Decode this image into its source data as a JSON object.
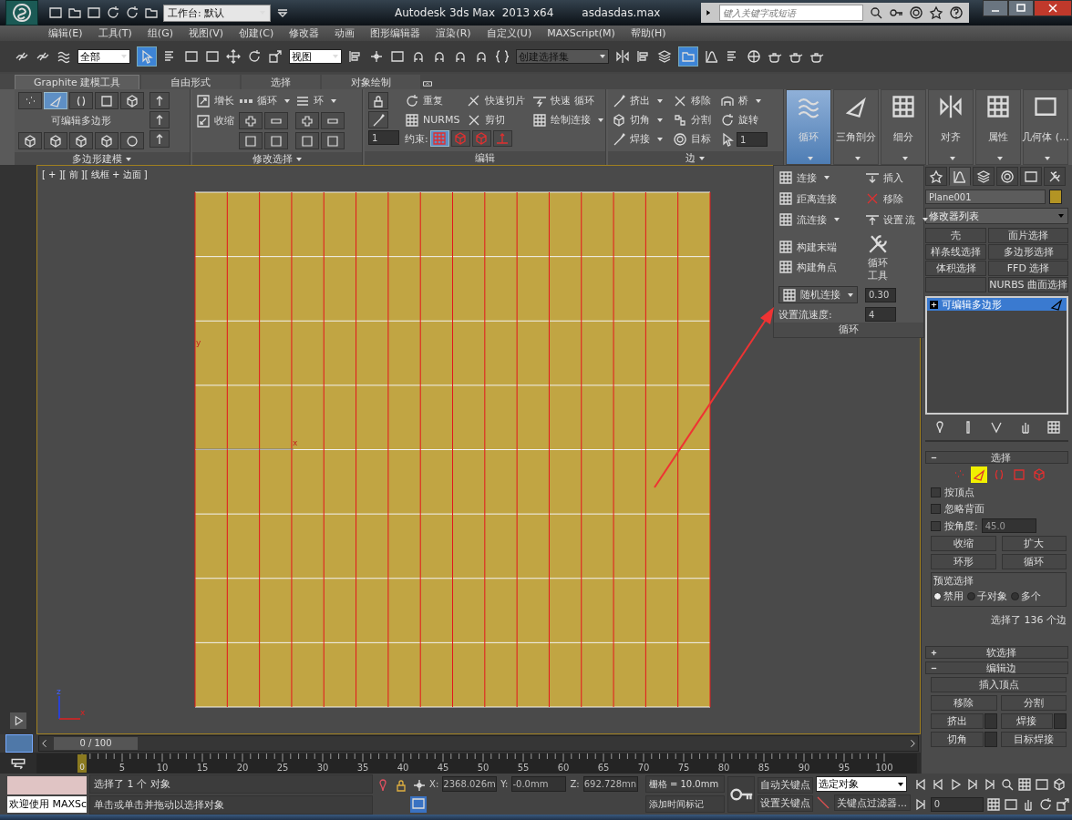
{
  "title_bar": {
    "workspace": "工作台: 默认",
    "app_title": "Autodesk 3ds Max  2013 x64",
    "file_name": "asdasdas.max",
    "search": {
      "placeholder": "键入关键字或短语"
    }
  },
  "menu_bar": [
    "编辑(E)",
    "工具(T)",
    "组(G)",
    "视图(V)",
    "创建(C)",
    "修改器",
    "动画",
    "图形编辑器",
    "渲染(R)",
    "自定义(U)",
    "MAXScript(M)",
    "帮助(H)"
  ],
  "main_toolbar": {
    "selection_filter": "全部",
    "select_object": {
      "on": true
    },
    "reference_coordinate": "视图",
    "named_selection_set": "创建选择集",
    "ribbon_toggle": {
      "on": true
    }
  },
  "ribbon": {
    "tabs": [
      {
        "label": "Graphite 建模工具",
        "selected": true
      },
      {
        "label": "自由形式",
        "selected": false
      },
      {
        "label": "选择",
        "selected": false
      },
      {
        "label": "对象绘制",
        "selected": false
      }
    ],
    "polygon_modeling": {
      "title": "多边形建模",
      "object_type": "可编辑多边形",
      "subobject_levels": [
        {
          "kind": "vertex",
          "selected": false
        },
        {
          "kind": "edge",
          "selected": true
        },
        {
          "kind": "border",
          "selected": false
        },
        {
          "kind": "polygon",
          "selected": false
        },
        {
          "kind": "element",
          "selected": false
        }
      ]
    },
    "modify_selection": {
      "title": "修改选择",
      "grow": "增长",
      "shrink": "收缩",
      "loop": "循环",
      "ring": "环"
    },
    "edit": {
      "title": "编辑",
      "repeat": "重复",
      "quickslice": "快速切片",
      "swiftloop": "快速 循环",
      "nurms": "NURMS",
      "cut": "剪切",
      "paint_connect": "绘制连接",
      "constraints_label": "约束:",
      "constraints": [
        {
          "kind": "none",
          "selected": true
        },
        {
          "kind": "edge",
          "selected": false
        },
        {
          "kind": "face",
          "selected": false
        },
        {
          "kind": "normal",
          "selected": false
        }
      ],
      "spinner": "1"
    },
    "edges": {
      "title": "边",
      "tools": [
        {
          "label": "挤出",
          "dropdown": true
        },
        {
          "label": "移除",
          "dropdown": false
        },
        {
          "label": "桥",
          "dropdown": true
        },
        {
          "label": "切角",
          "dropdown": true
        },
        {
          "label": "分割",
          "dropdown": false
        },
        {
          "label": "旋转",
          "dropdown": false
        },
        {
          "label": "焊接",
          "dropdown": true
        },
        {
          "label": "目标",
          "dropdown": false
        }
      ],
      "spinner": "1"
    },
    "large_buttons": [
      {
        "label": "循环",
        "selected": true
      },
      {
        "label": "三角剖分",
        "selected": false
      },
      {
        "label": "细分",
        "selected": false
      },
      {
        "label": "对齐",
        "selected": false
      },
      {
        "label": "属性",
        "selected": false
      },
      {
        "label": "几何体 (...",
        "selected": false
      }
    ]
  },
  "loop_flyout": {
    "title": "循环",
    "connect": "连接",
    "insert": "插入",
    "distance_connect": "距离连接",
    "remove": "移除",
    "flow_connect": "流连接",
    "set_flow": "设置",
    "flow": "流",
    "build_end": "构建末端",
    "build_corner": "构建角点",
    "loop_tools": [
      "循环",
      "工具"
    ],
    "random_connect": "随机连接",
    "random_value": "0.30",
    "set_flow_speed": "设置流速度:",
    "flow_speed": "4"
  },
  "viewport": {
    "label": "[ + ][ 前 ][ 线框 + 边面 ]",
    "gizmo": {
      "x": "x",
      "y": "y"
    },
    "world_axes": {
      "x": "x",
      "z": "z"
    }
  },
  "command_panel": {
    "tabs": [
      {
        "kind": "create",
        "selected": false
      },
      {
        "kind": "modify",
        "selected": true
      },
      {
        "kind": "hierarchy",
        "selected": false
      },
      {
        "kind": "motion",
        "selected": false
      },
      {
        "kind": "display",
        "selected": false
      },
      {
        "kind": "utilities",
        "selected": false
      }
    ],
    "object": {
      "name": "Plane001",
      "color": "#b39424"
    },
    "modifier_list": "修改器列表",
    "modifier_buttons": [
      {
        "kind": "button",
        "label": "壳"
      },
      {
        "kind": "button",
        "label": "面片选择"
      },
      {
        "kind": "button",
        "label": "样条线选择"
      },
      {
        "kind": "button",
        "label": "多边形选择"
      },
      {
        "kind": "button",
        "label": "体积选择"
      },
      {
        "kind": "button",
        "label": "FFD 选择"
      },
      {
        "kind": "blank"
      },
      {
        "kind": "button",
        "label": "NURBS 曲面选择"
      }
    ],
    "stack": [
      {
        "label": "可编辑多边形",
        "selected": true,
        "expanded": false
      }
    ],
    "selection_rollout": {
      "title": "选择",
      "expanded": true,
      "levels": [
        {
          "kind": "vertex",
          "selected": false
        },
        {
          "kind": "edge",
          "selected": true
        },
        {
          "kind": "border",
          "selected": false
        },
        {
          "kind": "polygon",
          "selected": false
        },
        {
          "kind": "element",
          "selected": false
        }
      ],
      "options": [
        {
          "label": "按顶点",
          "checked": false
        },
        {
          "label": "忽略背面",
          "checked": false
        },
        {
          "label": "按角度:",
          "checked": false,
          "value": "45.0"
        }
      ],
      "shrink": "收缩",
      "grow": "扩大",
      "ring": "环形",
      "loop": "循环",
      "preview": {
        "title": "预览选择",
        "options": [
          {
            "label": "禁用",
            "selected": true
          },
          {
            "label": "子对象",
            "selected": false
          },
          {
            "label": "多个",
            "selected": false
          }
        ]
      },
      "status": "选择了 136 个边"
    },
    "soft_selection_rollout": {
      "title": "软选择",
      "expanded": false
    },
    "edit_edges_rollout": {
      "title": "编辑边",
      "expanded": true,
      "buttons": [
        {
          "label": "插入顶点",
          "kind": "full"
        },
        {
          "label": "移除",
          "kind": "half"
        },
        {
          "label": "分割",
          "kind": "half"
        },
        {
          "label": "挤出",
          "kind": "settings"
        },
        {
          "label": "焊接",
          "kind": "settings"
        },
        {
          "label": "切角",
          "kind": "settings"
        },
        {
          "label": "目标焊接",
          "kind": "half"
        }
      ]
    }
  },
  "time_slider": {
    "position": "0 / 100",
    "frame": "0",
    "ticks": [
      "5",
      "10",
      "15",
      "20",
      "25",
      "30",
      "35",
      "40",
      "45",
      "50",
      "55",
      "60",
      "65",
      "70",
      "75",
      "80",
      "85",
      "90",
      "95",
      "100"
    ]
  },
  "status_bar": {
    "listener_output": "欢迎使用 MAXSc",
    "prompt": "选择了 1 个 对象",
    "hint": "单击或单击并拖动以选择对象",
    "x_label": "X:",
    "x": "2368.026m",
    "y_label": "Y:",
    "y": "-0.0mm",
    "z_label": "Z:",
    "z": "692.728mn",
    "grid": "栅格 = 10.0mm",
    "time_tag": "添加时间标记",
    "auto_key": "自动关键点",
    "set_key": "设置关键点",
    "key_mode": "选定对象",
    "key_filters": "关键点过滤器...",
    "current_frame": "0"
  }
}
